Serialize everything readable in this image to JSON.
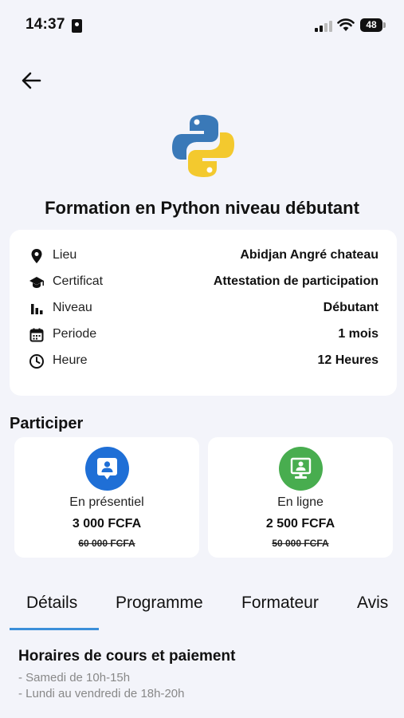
{
  "status_bar": {
    "time": "14:37",
    "battery": "48"
  },
  "course": {
    "title": "Formation en Python niveau débutant",
    "logo_icon": "python-logo"
  },
  "info": [
    {
      "icon": "location-pin-icon",
      "label": "Lieu",
      "value": "Abidjan Angré chateau"
    },
    {
      "icon": "graduation-cap-icon",
      "label": "Certificat",
      "value": "Attestation de participation"
    },
    {
      "icon": "bar-chart-icon",
      "label": "Niveau",
      "value": "Débutant"
    },
    {
      "icon": "calendar-icon",
      "label": "Periode",
      "value": "1 mois"
    },
    {
      "icon": "clock-icon",
      "label": "Heure",
      "value": "12 Heures"
    }
  ],
  "participate": {
    "title": "Participer",
    "options": [
      {
        "name": "En présentiel",
        "price": "3 000 FCFA",
        "old_price": "60 000 FCFA",
        "icon": "person-card-icon",
        "color": "#1f6fd6"
      },
      {
        "name": "En ligne",
        "price": "2 500 FCFA",
        "old_price": "50 000 FCFA",
        "icon": "screen-person-icon",
        "color": "#48ad4f"
      }
    ]
  },
  "tabs": [
    {
      "label": "Détails",
      "active": true
    },
    {
      "label": "Programme",
      "active": false
    },
    {
      "label": "Formateur",
      "active": false
    },
    {
      "label": "Avis",
      "active": false
    }
  ],
  "details": {
    "title": "Horaires de cours et paiement",
    "lines": [
      "- Samedi de 10h-15h",
      "- Lundi au vendredi de 18h-20h"
    ]
  },
  "colors": {
    "accent": "#3b8fd9",
    "background": "#f3f4fa"
  }
}
